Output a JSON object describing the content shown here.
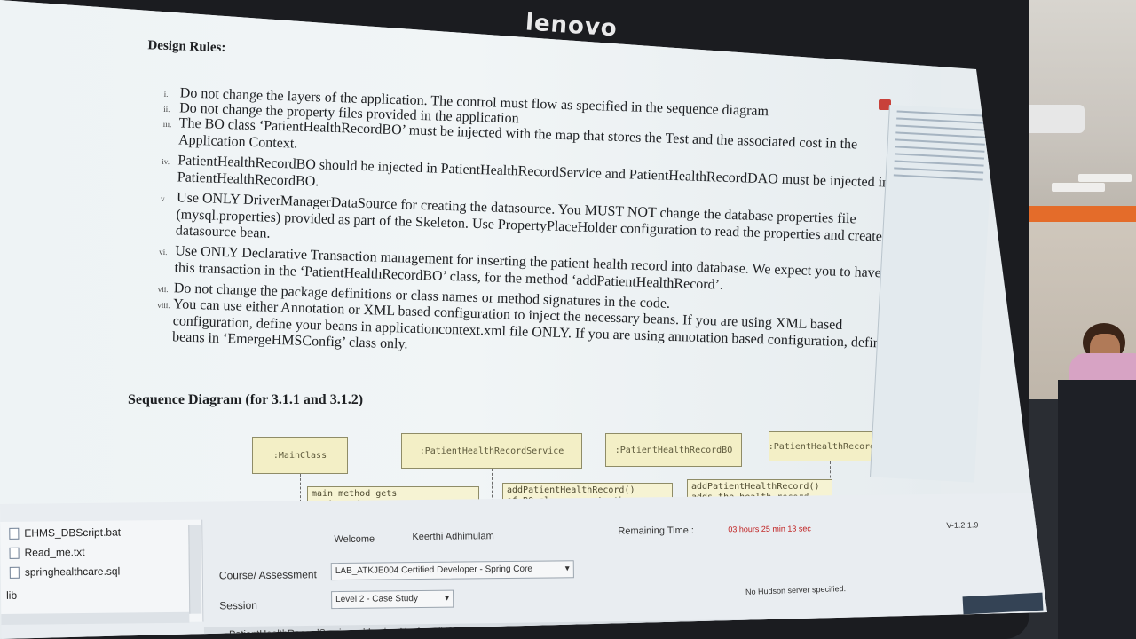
{
  "monitor": {
    "brand": "lenovo"
  },
  "document": {
    "design_rules_heading": "Design Rules:",
    "rules": [
      {
        "num": "i.",
        "text": "Do not change the layers of the application. The control must flow as specified in the sequence diagram"
      },
      {
        "num": "ii.",
        "text": "Do not change the property files provided in the application"
      },
      {
        "num": "iii.",
        "text": "The BO class ‘PatientHealthRecordBO’ must be injected with the map that stores the Test and the associated cost in the",
        "cont": "Application Context."
      },
      {
        "num": "iv.",
        "text": "PatientHealthRecordBO should be injected in PatientHealthRecordService and PatientHealthRecordDAO must be injected in",
        "cont": "PatientHealthRecordBO."
      },
      {
        "num": "v.",
        "text": "Use ONLY DriverManagerDataSource for creating the datasource. You MUST NOT change the database properties file",
        "cont": "(mysql.properties) provided as part of the Skeleton. Use PropertyPlaceHolder configuration to read the properties and create the",
        "cont2": "datasource bean."
      },
      {
        "num": "vi.",
        "text": "Use ONLY Declarative Transaction management for inserting the patient health record into database. We expect you to have",
        "cont": "this transaction in the ‘PatientHealthRecordBO’ class, for the method ‘addPatientHealthRecord’."
      },
      {
        "num": "vii.",
        "text": "Do not change the package definitions or class names or method signatures in the code."
      },
      {
        "num": "viii.",
        "text": "You can use either Annotation or XML based configuration to inject the necessary beans. If you are using XML based",
        "cont": "configuration, define your beans in applicationcontext.xml file ONLY. If you are using annotation based configuration, define your",
        "cont2": "beans in ‘EmergeHMSConfig’ class only."
      }
    ],
    "sequence_heading": "Sequence Diagram (for 3.1.1 and 3.1.2)",
    "diagram": {
      "boxes": [
        ":MainClass",
        ":PatientHealthRecordService",
        ":PatientHealthRecordBO",
        ":PatientHealthRecordDAO"
      ],
      "notes": [
        "main method gets\npatientId and testName",
        "addPatientHealthRecord()\nof BO class accepts the",
        "addPatientHealthRecord()\nadds the health record"
      ]
    }
  },
  "files": [
    "EHMS_DBScript.bat",
    "Read_me.txt",
    "springhealthcare.sql",
    "lib"
  ],
  "assessment": {
    "welcome_label": "Welcome",
    "user_name": "Keerthi Adhimulam",
    "remaining_label": "Remaining Time :",
    "remaining_value": "03 hours 25 min 13 sec",
    "version": "V-1.2.1.9",
    "course_label": "Course/ Assessment",
    "course_value": "LAB_ATKJE004 Certified Developer - Spring Core",
    "session_label": "Session",
    "session_value": "Level 2 - Case Study"
  },
  "status_bar": {
    "path": "PatientHealthRecordService.addpatientHeal...validDiagnosticTestException : void - EmergeHosptalSystem_Skeleton/src",
    "hudson": "No Hudson server specified."
  }
}
